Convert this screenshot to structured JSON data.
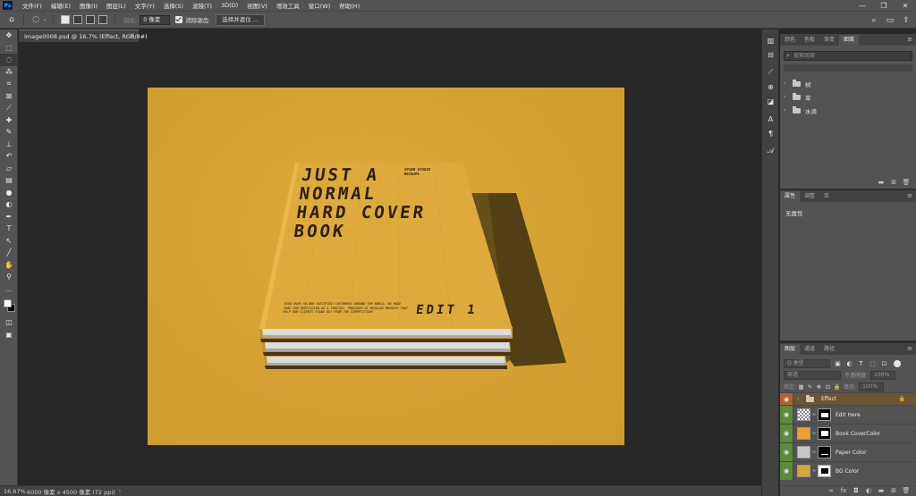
{
  "app": {
    "logo": "Ps"
  },
  "menu": [
    "文件(F)",
    "编辑(E)",
    "图像(I)",
    "图层(L)",
    "文字(Y)",
    "选择(S)",
    "滤镜(T)",
    "3D(D)",
    "视图(V)",
    "增效工具",
    "窗口(W)",
    "帮助(H)"
  ],
  "window_controls": [
    "—",
    "❐",
    "✕"
  ],
  "options": {
    "feather_label": "羽化:",
    "feather_value": "0 像素",
    "antialias_label": "消除锯齿",
    "select_mask_button": "选择并遮住 ..."
  },
  "document": {
    "tab_title": "Image0008.psd @ 16.7% (Effect, RGB/8#)",
    "close": "×"
  },
  "cover": {
    "title": "JUST A\nNORMAL\nHARD COVER\nBOOK",
    "small_text": "RYVER STUDIO MOCKUPS",
    "edit_text": "EDIT 1",
    "fine_print": "USED OVER 50,000 SATISFIED CUSTOMERS AROUND THE WORLD, WE MADE SURE OUR REPUTATION AS A TRUSTED. PROVIDER OF REGULAR MOCKUPS THAT HELP OUR CLIENTS STAND OUT FROM THE COMPETITION!"
  },
  "status": {
    "zoom": "16.67%",
    "doc_info": "6000 像素 x 4500 像素 (72 ppi)",
    "arrow": "›"
  },
  "swatch_panel": {
    "tabs": [
      "颜色",
      "色板",
      "渐变",
      "图案"
    ],
    "active_tab": 3,
    "search_placeholder": "搜索图案",
    "groups": [
      "树",
      "草",
      "水滴"
    ]
  },
  "props_panel": {
    "tabs": [
      "属性",
      "调整",
      "库"
    ],
    "active_tab": 0,
    "text": "无属性"
  },
  "layers_panel": {
    "tabs": [
      "图层",
      "通道",
      "路径"
    ],
    "active_tab": 0,
    "kind_select": "Q 类型",
    "blend_select": "穿透",
    "opacity_label": "不透明度:",
    "opacity_value": "100%",
    "lock_label": "锁定:",
    "fill_label": "填充:",
    "fill_value": "100%",
    "layers": [
      {
        "name": "Effect",
        "type": "group",
        "eye": "orange",
        "locked": true
      },
      {
        "name": "Edit Here",
        "type": "smart",
        "eye": "green",
        "thumb_color": "#e8e8e8"
      },
      {
        "name": "Book CoverColor",
        "type": "fill",
        "eye": "green",
        "thumb_color": "#f0a02e"
      },
      {
        "name": "Paper Color",
        "type": "fill",
        "eye": "green",
        "thumb_color": "#c8c8c8"
      },
      {
        "name": "BG Color",
        "type": "fill",
        "eye": "green",
        "thumb_color": "#d9a23a"
      }
    ]
  },
  "colors": {
    "canvas_bg": "#d6a533",
    "book_cover": "#dbaa3a",
    "accent_green": "#5c8a3d",
    "accent_orange": "#b0642c"
  }
}
